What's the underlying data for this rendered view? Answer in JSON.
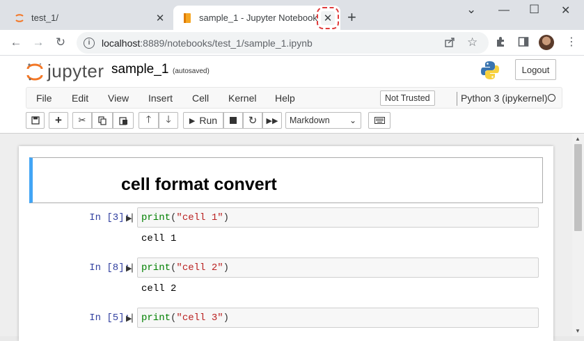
{
  "browser": {
    "tabs": [
      {
        "label": "test_1/",
        "favicon": "jupyter-favicon-icon",
        "active": false
      },
      {
        "label": "sample_1 - Jupyter Notebook",
        "favicon": "notebook-favicon-icon",
        "active": true
      }
    ],
    "close_glyph": "✕",
    "new_tab_glyph": "+",
    "window": {
      "minimize": "⌄",
      "restore": "—",
      "maximize": "☐",
      "close": "✕"
    },
    "url_host": "localhost",
    "url_rest": ":8889/notebooks/test_1/sample_1.ipynb"
  },
  "jupyter": {
    "logo_text": "jupyter",
    "notebook_name": "sample_1",
    "autosave_status": "(autosaved)",
    "logout_label": "Logout",
    "menu": [
      "File",
      "Edit",
      "View",
      "Insert",
      "Cell",
      "Kernel",
      "Help"
    ],
    "trust_label": "Not Trusted",
    "kernel_name": "Python 3 (ipykernel)",
    "run_label": "Run",
    "cell_type": "Markdown"
  },
  "cells": {
    "markdown_heading": "cell format convert",
    "code": [
      {
        "prompt": "In [3]:",
        "func": "print",
        "arg": "\"cell 1\"",
        "output": "cell 1"
      },
      {
        "prompt": "In [8]:",
        "func": "print",
        "arg": "\"cell 2\"",
        "output": "cell 2"
      },
      {
        "prompt": "In [5]:",
        "func": "print",
        "arg": "\"cell 3\"",
        "output": ""
      }
    ]
  },
  "colors": {
    "accent_blue": "#42a5f5",
    "prompt_blue": "#303f9f",
    "keyword_green": "#008000",
    "string_red": "#ba2121",
    "highlight_red": "#e03b3b"
  }
}
